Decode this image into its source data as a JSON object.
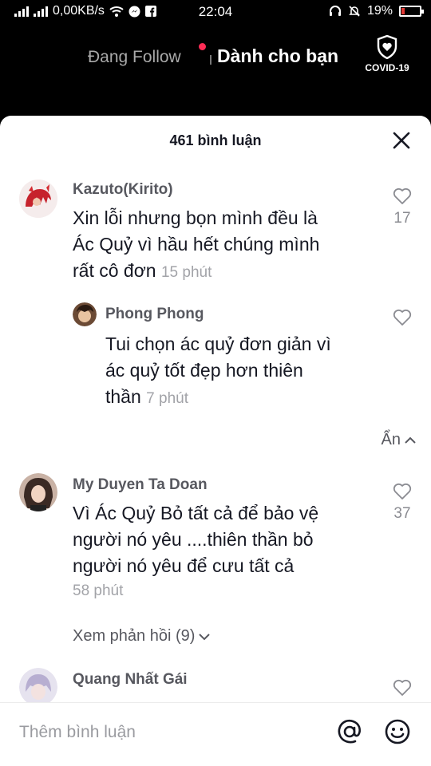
{
  "status_bar": {
    "network_speed": "0,00KB/s",
    "time": "22:04",
    "battery": "19%",
    "battery_level": 0.19
  },
  "top_nav": {
    "following_label": "Đang Follow",
    "for_you_label": "Dành cho bạn",
    "covid_label": "COVID-19"
  },
  "comments_sheet": {
    "title": "461 bình luận",
    "comments": [
      {
        "user": "Kazuto(Kirito)",
        "text_lines": [
          "Xin lỗi nhưng bọn mình đều là",
          "Ác Quỷ vì hầu hết chúng mình",
          "rất cô đơn"
        ],
        "time": "15 phút",
        "likes": "17"
      },
      {
        "user": "Phong Phong",
        "text_lines": [
          "Tui chọn ác quỷ đơn giản vì",
          "ác quỷ tốt đẹp hơn thiên",
          "thần"
        ],
        "time": "7 phút"
      },
      {
        "user": "My Duyen Ta Doan",
        "text_lines": [
          "Vì Ác Quỷ Bỏ tất cả để bảo vệ",
          "người nó yêu ....thiên thần bỏ",
          "người nó yêu để cưu tất cả"
        ],
        "time": "58 phút",
        "likes": "37"
      },
      {
        "user": "Quang Nhất Gái"
      }
    ],
    "hide_label": "Ẩn",
    "view_replies_label": "Xem phản hồi (9)"
  },
  "input_bar": {
    "placeholder": "Thêm bình luận"
  },
  "colors": {
    "accent": "#fe2c55",
    "battery_low": "#e53935"
  }
}
